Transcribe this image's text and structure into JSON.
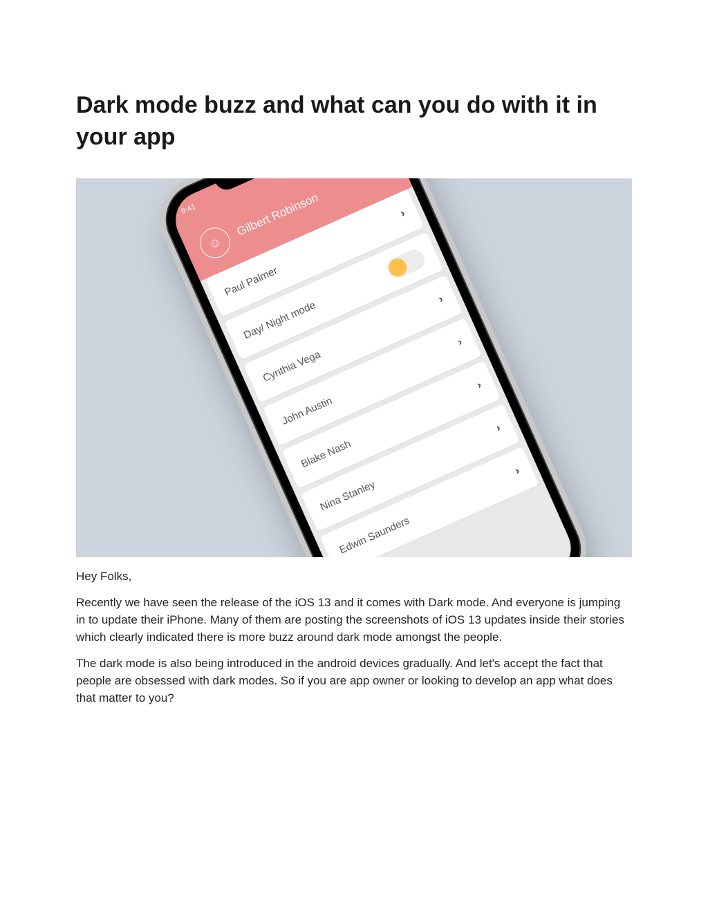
{
  "title": "Dark mode buzz and what can you do with it in your app",
  "hero": {
    "bg": "#cdd4de",
    "status": {
      "time": "9:41",
      "signal_icon": "signal-icon",
      "wifi_icon": "wifi-icon",
      "battery_icon": "battery-icon"
    },
    "user": {
      "name": "Gilbert Robinson",
      "avatar_icon": "smiley-icon"
    },
    "rows": [
      {
        "label": "Paul Palmer",
        "kind": "chevron"
      },
      {
        "label": "Day/ Night mode",
        "kind": "toggle"
      },
      {
        "label": "Cynthia Vega",
        "kind": "chevron"
      },
      {
        "label": "John Austin",
        "kind": "chevron"
      },
      {
        "label": "Blake Nash",
        "kind": "chevron"
      },
      {
        "label": "Nina Stanley",
        "kind": "chevron"
      },
      {
        "label": "Edwin Saunders",
        "kind": "chevron"
      }
    ]
  },
  "body": {
    "greeting": "Hey Folks,",
    "p1": "Recently we have seen the release of the iOS 13 and it comes with Dark mode. And everyone is jumping in to update their iPhone. Many of them are posting the screenshots of iOS 13 updates inside their stories which clearly indicated there is more buzz around dark mode amongst the people.",
    "p2": "The dark mode is also being introduced in the android devices gradually. And let's accept the fact that people are obsessed with dark modes. So if you are app owner or looking to develop an app what does that matter to you?"
  }
}
